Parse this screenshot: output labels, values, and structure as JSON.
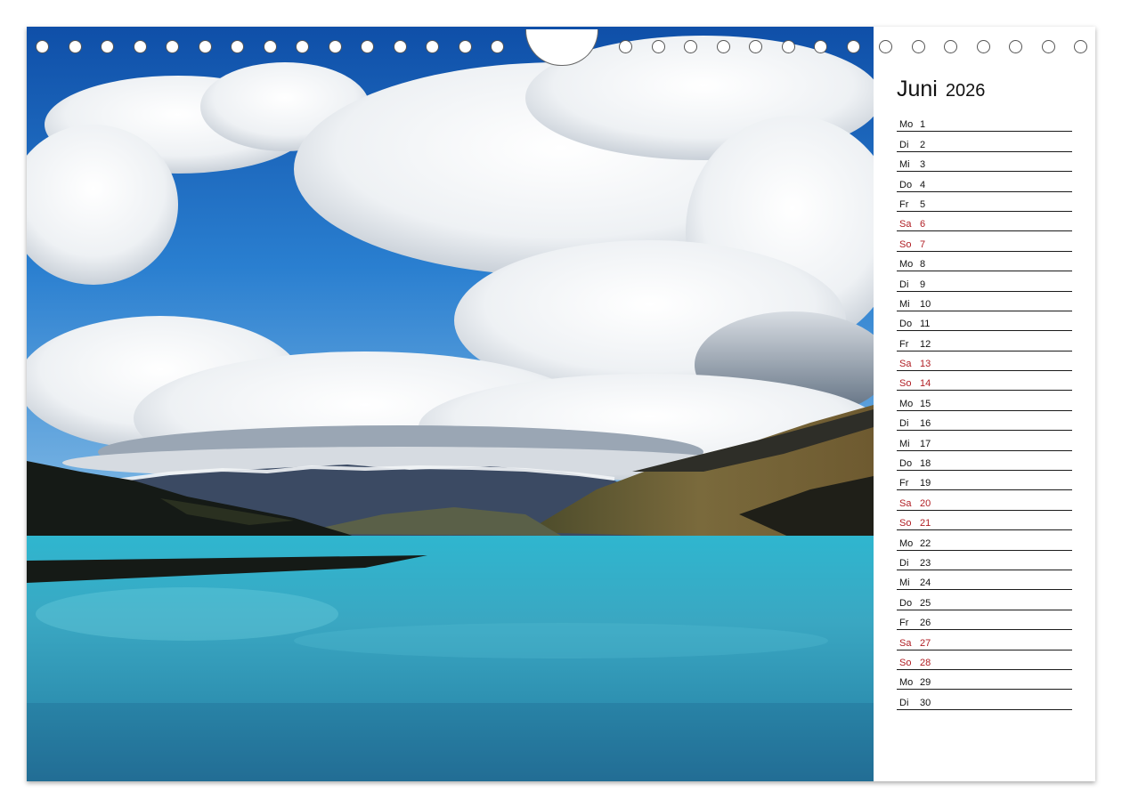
{
  "calendar": {
    "month": "Juni",
    "year": "2026",
    "days": [
      {
        "dn": "Mo",
        "d": "1",
        "weekend": false
      },
      {
        "dn": "Di",
        "d": "2",
        "weekend": false
      },
      {
        "dn": "Mi",
        "d": "3",
        "weekend": false
      },
      {
        "dn": "Do",
        "d": "4",
        "weekend": false
      },
      {
        "dn": "Fr",
        "d": "5",
        "weekend": false
      },
      {
        "dn": "Sa",
        "d": "6",
        "weekend": true
      },
      {
        "dn": "So",
        "d": "7",
        "weekend": true
      },
      {
        "dn": "Mo",
        "d": "8",
        "weekend": false
      },
      {
        "dn": "Di",
        "d": "9",
        "weekend": false
      },
      {
        "dn": "Mi",
        "d": "10",
        "weekend": false
      },
      {
        "dn": "Do",
        "d": "11",
        "weekend": false
      },
      {
        "dn": "Fr",
        "d": "12",
        "weekend": false
      },
      {
        "dn": "Sa",
        "d": "13",
        "weekend": true
      },
      {
        "dn": "So",
        "d": "14",
        "weekend": true
      },
      {
        "dn": "Mo",
        "d": "15",
        "weekend": false
      },
      {
        "dn": "Di",
        "d": "16",
        "weekend": false
      },
      {
        "dn": "Mi",
        "d": "17",
        "weekend": false
      },
      {
        "dn": "Do",
        "d": "18",
        "weekend": false
      },
      {
        "dn": "Fr",
        "d": "19",
        "weekend": false
      },
      {
        "dn": "Sa",
        "d": "20",
        "weekend": true
      },
      {
        "dn": "So",
        "d": "21",
        "weekend": true
      },
      {
        "dn": "Mo",
        "d": "22",
        "weekend": false
      },
      {
        "dn": "Di",
        "d": "23",
        "weekend": false
      },
      {
        "dn": "Mi",
        "d": "24",
        "weekend": false
      },
      {
        "dn": "Do",
        "d": "25",
        "weekend": false
      },
      {
        "dn": "Fr",
        "d": "26",
        "weekend": false
      },
      {
        "dn": "Sa",
        "d": "27",
        "weekend": true
      },
      {
        "dn": "So",
        "d": "28",
        "weekend": true
      },
      {
        "dn": "Mo",
        "d": "29",
        "weekend": false
      },
      {
        "dn": "Di",
        "d": "30",
        "weekend": false
      }
    ]
  },
  "colors": {
    "weekend": "#b01e24",
    "text": "#111111",
    "sky": "#1d63b8",
    "lake": "#3fb2c9"
  },
  "binding": {
    "holes_left_count": 15,
    "holes_right_count": 15
  }
}
